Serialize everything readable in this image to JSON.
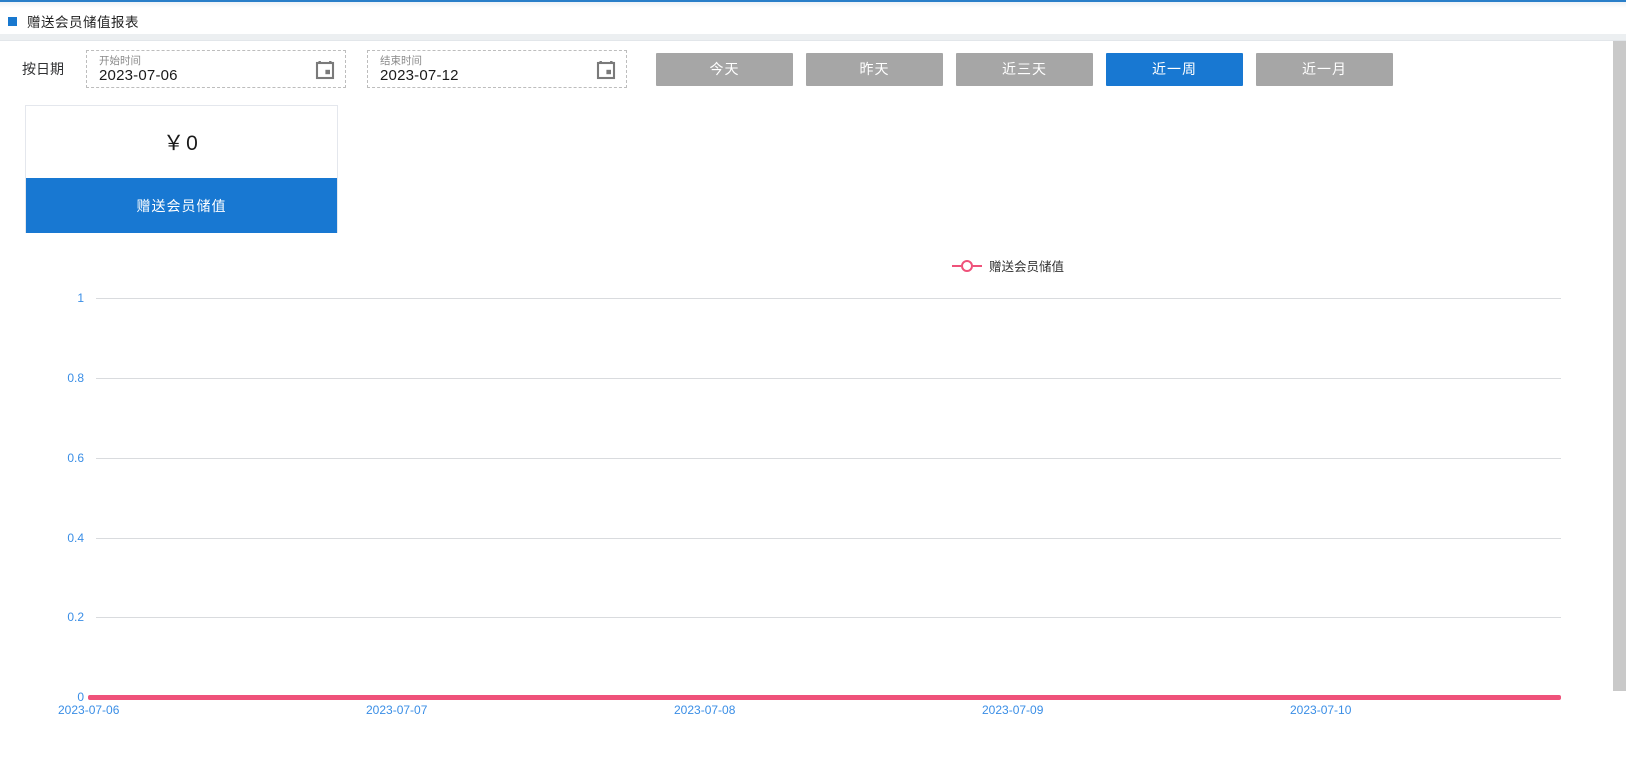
{
  "window": {
    "title": "赠送会员储值报表",
    "bullet_icon": "blue-square-icon"
  },
  "filters": {
    "label": "按日期",
    "start_date": {
      "caption": "开始时间",
      "value": "2023-07-06",
      "icon": "calendar-icon"
    },
    "end_date": {
      "caption": "结束时间",
      "value": "2023-07-12",
      "icon": "calendar-icon"
    },
    "range_buttons": [
      {
        "label": "今天",
        "active": false
      },
      {
        "label": "昨天",
        "active": false
      },
      {
        "label": "近三天",
        "active": false
      },
      {
        "label": "近一周",
        "active": true
      },
      {
        "label": "近一月",
        "active": false
      }
    ]
  },
  "stat_card": {
    "value": "￥0",
    "footer_label": "赠送会员储值"
  },
  "colors": {
    "primary": "#1878d2",
    "button_idle": "#a6a6a6",
    "series": "#ef527a",
    "axis_text": "#3a8ee6",
    "grid": "#d9dbde"
  },
  "chart_data": {
    "type": "line",
    "title": "",
    "xlabel": "",
    "ylabel": "",
    "legend": [
      "赠送会员储值"
    ],
    "legend_position": "top-center",
    "grid": true,
    "x": [
      "2023-07-06",
      "2023-07-07",
      "2023-07-08",
      "2023-07-09",
      "2023-07-10"
    ],
    "ylim": [
      0,
      1
    ],
    "yticks": [
      "1",
      "0.8",
      "0.6",
      "0.4",
      "0.2",
      "0"
    ],
    "series": [
      {
        "name": "赠送会员储值",
        "values": [
          0,
          0,
          0,
          0,
          0
        ],
        "color": "#ef527a"
      }
    ]
  },
  "scrollbar": {
    "name": "vertical-scrollbar"
  }
}
